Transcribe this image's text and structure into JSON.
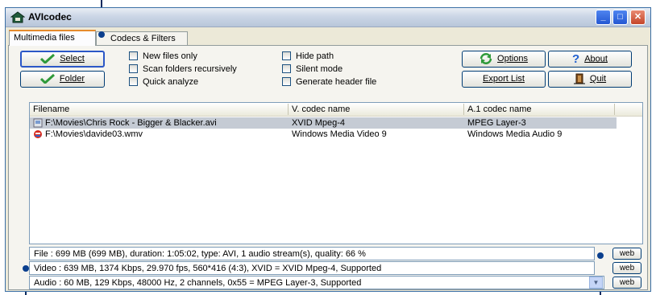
{
  "window": {
    "title": "AVIcodec",
    "controls": {
      "minimize": "_",
      "maximize": "□",
      "close": "✕"
    }
  },
  "tabs": [
    {
      "label": "Multimedia files",
      "active": true
    },
    {
      "label": "Codecs & Filters",
      "active": false
    }
  ],
  "actions": {
    "select": "Select",
    "folder": "Folder",
    "options": "Options",
    "about": "About",
    "export": "Export List",
    "quit": "Quit"
  },
  "options": {
    "new_files_only": "New files only",
    "scan_recursive": "Scan folders recursively",
    "quick_analyze": "Quick analyze",
    "hide_path": "Hide path",
    "silent_mode": "Silent mode",
    "generate_header": "Generate header file"
  },
  "list": {
    "columns": [
      "Filename",
      "V. codec name",
      "A.1 codec name"
    ],
    "rows": [
      {
        "file": "F:\\Movies\\Chris Rock - Bigger & Blacker.avi",
        "vcodec": "XVID Mpeg-4",
        "acodec": "MPEG Layer-3",
        "selected": true
      },
      {
        "file": "F:\\Movies\\davide03.wmv",
        "vcodec": "Windows Media Video 9",
        "acodec": "Windows Media Audio 9",
        "selected": false
      }
    ]
  },
  "info": {
    "file": "File   :  699 MB (699 MB),  duration: 1:05:02,  type: AVI,  1 audio stream(s),  quality: 66 %",
    "video": "Video :  639 MB,  1374 Kbps,  29.970 fps,  560*416 (4:3),  XVID = XVID Mpeg-4,   Supported",
    "audio": "Audio :  60 MB,  129 Kbps,  48000 Hz,  2 channels,  0x55 = MPEG Layer-3,   Supported",
    "web_label": "web"
  },
  "colors": {
    "accent": "#e68b2c",
    "selection": "#c5cbd4",
    "marker": "#0b3f8e"
  }
}
